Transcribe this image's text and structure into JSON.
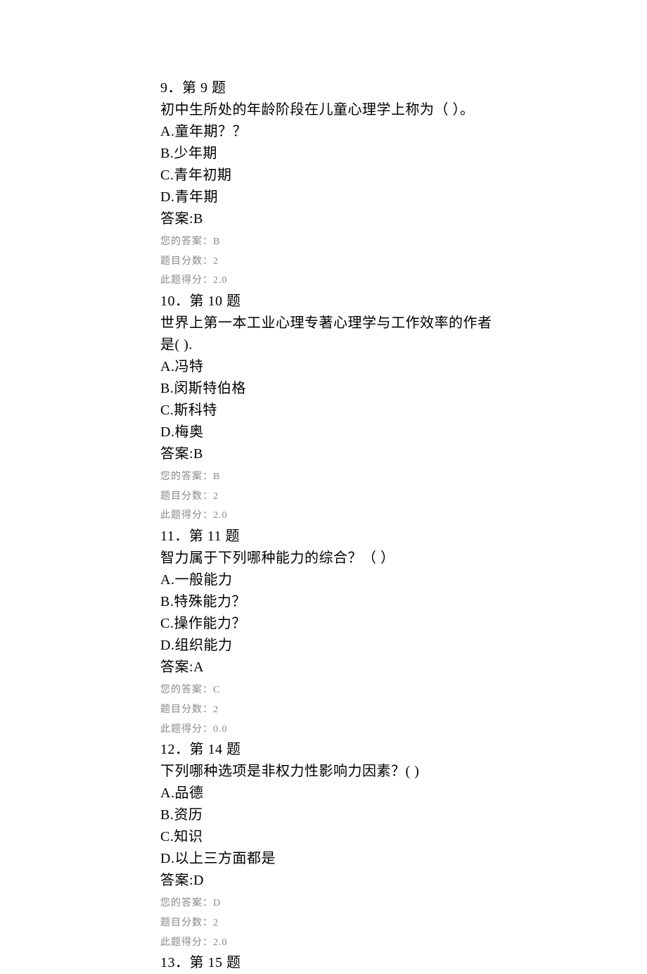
{
  "questions": [
    {
      "num_label": "9．第 9 题",
      "stem": "初中生所处的年龄阶段在儿童心理学上称为（ ）。",
      "stem2": "",
      "optA": "A.童年期？？",
      "optB": "B.少年期",
      "optC": "C.青年初期",
      "optD": "D.青年期",
      "answer_label": "答案:B",
      "your_answer": "您的答案：B",
      "full_score": "题目分数：2",
      "got_score": "此题得分：2.0"
    },
    {
      "num_label": "10．第 10 题",
      "stem": "世界上第一本工业心理专著心理学与工作效率的作者",
      "stem2": "是( ).",
      "optA": "A.冯特",
      "optB": "B.闵斯特伯格",
      "optC": "C.斯科特",
      "optD": "D.梅奥",
      "answer_label": "答案:B",
      "your_answer": "您的答案：B",
      "full_score": "题目分数：2",
      "got_score": "此题得分：2.0"
    },
    {
      "num_label": "11．第 11 题",
      "stem": "智力属于下列哪种能力的综合？（ ）",
      "stem2": "",
      "optA": "A.一般能力",
      "optB": "B.特殊能力？",
      "optC": "C.操作能力？",
      "optD": "D.组织能力",
      "answer_label": "答案:A",
      "your_answer": "您的答案：C",
      "full_score": "题目分数：2",
      "got_score": "此题得分：0.0"
    },
    {
      "num_label": "12．第 14 题",
      "stem": "下列哪种选项是非权力性影响力因素？( )",
      "stem2": "",
      "optA": "A.品德",
      "optB": "B.资历",
      "optC": "C.知识",
      "optD": "D.以上三方面都是",
      "answer_label": "答案:D",
      "your_answer": "您的答案：D",
      "full_score": "题目分数：2",
      "got_score": "此题得分：2.0"
    }
  ],
  "trailing_label": "13．第 15 题"
}
